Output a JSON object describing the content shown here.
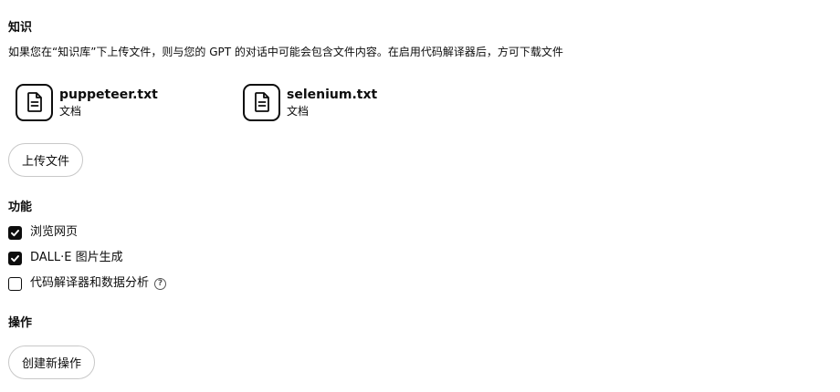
{
  "knowledge": {
    "title": "知识",
    "description": "如果您在“知识库”下上传文件，则与您的 GPT 的对话中可能会包含文件内容。在启用代码解译器后，方可下载文件",
    "files": [
      {
        "name": "puppeteer.txt",
        "type": "文档",
        "icon": "document-icon"
      },
      {
        "name": "selenium.txt",
        "type": "文档",
        "icon": "document-icon"
      }
    ],
    "upload_label": "上传文件"
  },
  "capabilities": {
    "title": "功能",
    "items": [
      {
        "label": "浏览网页",
        "checked": true
      },
      {
        "label": "DALL·E 图片生成",
        "checked": true
      },
      {
        "label": "代码解译器和数据分析",
        "checked": false,
        "help_icon": "question-circle-icon"
      }
    ]
  },
  "actions": {
    "title": "操作",
    "create_label": "创建新操作"
  }
}
